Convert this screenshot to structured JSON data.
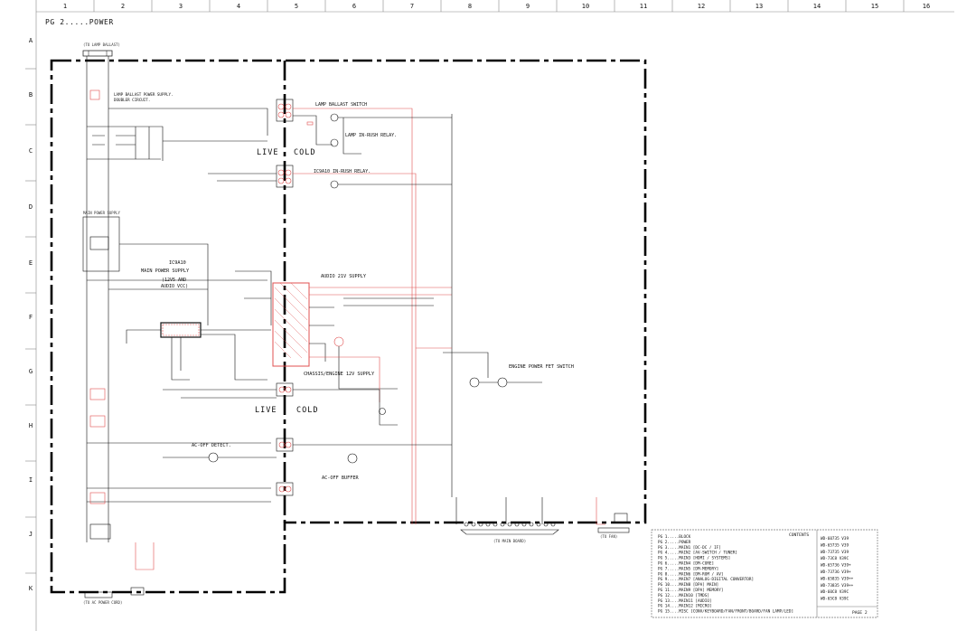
{
  "page_title": "PG 2.....POWER",
  "grid": {
    "columns": [
      "1",
      "2",
      "3",
      "4",
      "5",
      "6",
      "7",
      "8",
      "9",
      "10",
      "11",
      "12",
      "13",
      "14",
      "15",
      "16"
    ],
    "rows": [
      "A",
      "B",
      "C",
      "D",
      "E",
      "F",
      "G",
      "H",
      "I",
      "J",
      "K"
    ]
  },
  "blocks": {
    "lamp_ballast_top": "(TO LAMP BALLAST)",
    "lamp_ballast_power": "LAMP BALLAST POWER SUPPLY.",
    "lamp_ballast_power2": "DOUBLER CIRCUIT.",
    "lamp_ballast_switch": "LAMP BALLAST SWITCH",
    "lamp_inrush": "LAMP IN-RUSH RELAY.",
    "ic9a10_inrush": "IC9A10 IN-RUSH RELAY.",
    "live_top": "LIVE",
    "cold_top": "COLD",
    "main_power_note": "MAIN POWER SUPPLY",
    "ic9a10": "IC9A10",
    "main_power_supply": "MAIN POWER SUPPLY",
    "v12_audio": "(12V5 AND",
    "audio_vcc": "AUDIO VCC)",
    "audio_21v": "AUDIO 21V SUPPLY",
    "chassis_engine": "CHASSIS/ENGINE 12V SUPPLY",
    "engine_fet": "ENGINE POWER FET SWITCH",
    "live_bottom": "LIVE",
    "cold_bottom": "COLD",
    "ac_off_detect": "AC-OFF DETECT.",
    "ac_off_buffer": "AC-OFF BUFFER",
    "main_board": "(TO MAIN BOARD)",
    "ac_power_cord": "(TO AC POWER CORD)",
    "fan_label": "(TO FAN)"
  },
  "contents": {
    "heading": "CONTENTS",
    "page_label": "PAGE 2",
    "pages": [
      "PG 1.....BLOCK",
      "PG 2.....POWER",
      "PG 3.....MAIN1 [DC-DC / IF]",
      "PG 4.....MAIN2 [AV-SWITCH / TUNER]",
      "PG 5.....MAIN3 [HDMI / SYSTEMS]",
      "PG 6.....MAIN4 [DM-CORE]",
      "PG 7.....MAIN5 [DM-MEMORY]",
      "PG 8.....MAIN6 [DM-ROM / AV]",
      "PG 9.....MAIN7 [ANALOG-DIGITAL CONVERTOR]",
      "PG 10....MAIN8 [DPA] MAIN]",
      "PG 11....MAIN9 [DPA] MEMORY]",
      "PG 12....MAIN10 [TMDS]",
      "PG 13....MAIN11 [AUDIO]",
      "PG 14....MAIN12 [MICRO]",
      "PG 15....MISC [CONV/KEYBOARD/FAN/FRONT/BOARD/FAN LAMP/LED]"
    ],
    "models": [
      "WD-60735 V39",
      "WD-65735 V39",
      "WD-73735 V39",
      "WD-73C8 V39C",
      "WD-65736 V39+",
      "WD-73736 V39+",
      "WD-65835 V39++",
      "WD-73835 V39++",
      "WD-60C8 V39C",
      "WD-65C8 V39C"
    ]
  }
}
